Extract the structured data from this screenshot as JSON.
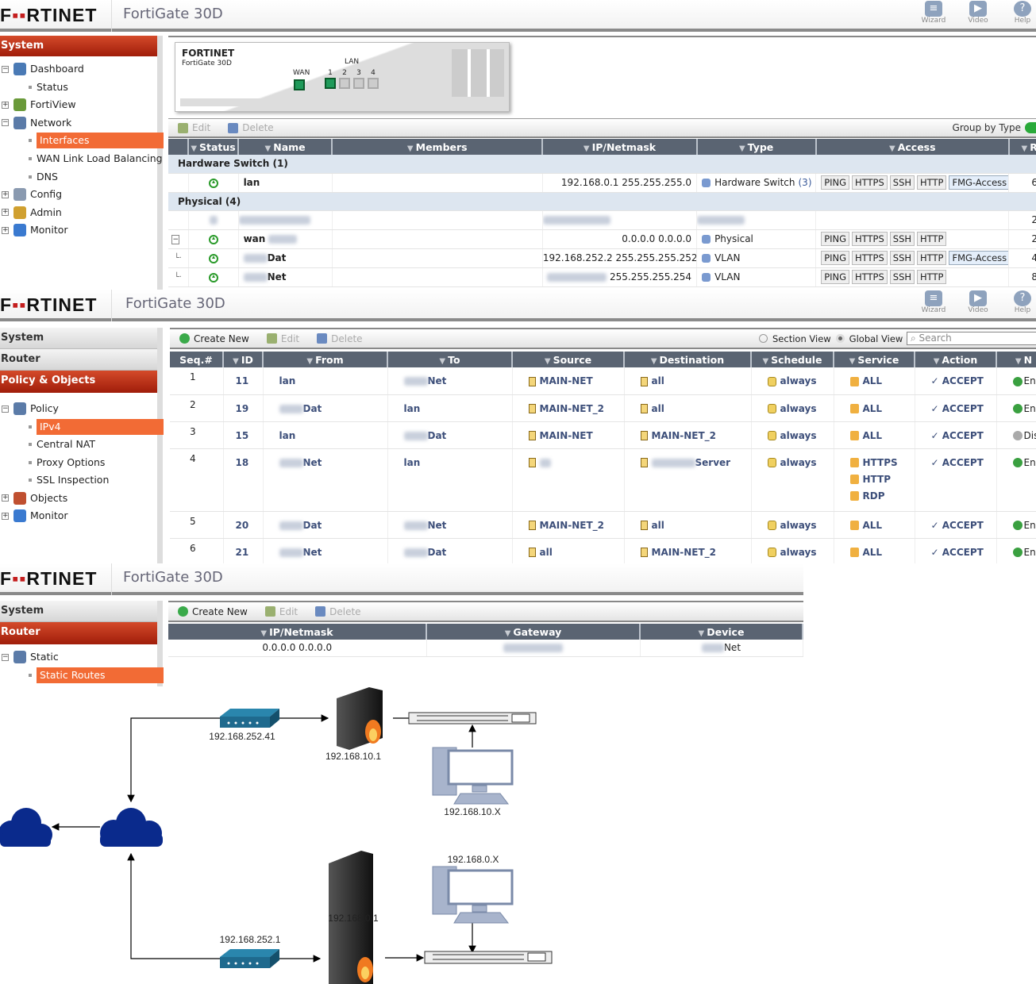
{
  "app": {
    "logo": "FORTINET",
    "product": "FortiGate 30D",
    "header_buttons": [
      {
        "label": "Wizard",
        "icon": "wizard-icon"
      },
      {
        "label": "Video",
        "icon": "video-icon"
      },
      {
        "label": "Help",
        "icon": "help-icon"
      }
    ]
  },
  "panel1": {
    "sidebar": {
      "section": "System",
      "items": [
        {
          "label": "Dashboard",
          "level": 0,
          "expander": "−",
          "icon": "dashboard-icon",
          "color": "#4a7ab5"
        },
        {
          "label": "Status",
          "level": 1
        },
        {
          "label": "FortiView",
          "level": 0,
          "expander": "+",
          "icon": "fortiview-icon",
          "color": "#6a9a3a"
        },
        {
          "label": "Network",
          "level": 0,
          "expander": "−",
          "icon": "network-icon",
          "color": "#5b7ba8"
        },
        {
          "label": "Interfaces",
          "level": 1,
          "selected": true
        },
        {
          "label": "WAN Link Load Balancing",
          "level": 1
        },
        {
          "label": "DNS",
          "level": 1
        },
        {
          "label": "Config",
          "level": 0,
          "expander": "+",
          "icon": "config-icon",
          "color": "#8a9ab0"
        },
        {
          "label": "Admin",
          "level": 0,
          "expander": "+",
          "icon": "admin-icon",
          "color": "#d0a030"
        },
        {
          "label": "Monitor",
          "level": 0,
          "expander": "+",
          "icon": "monitor-icon",
          "color": "#3a7ad0"
        }
      ]
    },
    "device": {
      "brand": "FORTINET",
      "model": "FortiGate 30D",
      "wan_label": "WAN",
      "lan_label": "LAN",
      "ports": [
        "1",
        "2",
        "3",
        "4"
      ],
      "active_ports": [
        true,
        false,
        false,
        false
      ]
    },
    "toolbar": {
      "edit": "Edit",
      "delete": "Delete",
      "group_by": "Group by Type"
    },
    "columns": [
      "Status",
      "Name",
      "Members",
      "IP/Netmask",
      "Type",
      "Access",
      "Re"
    ],
    "rows": [
      {
        "group": "Hardware Switch (1)"
      },
      {
        "status": "up",
        "name": "lan",
        "ip": "192.168.0.1 255.255.255.0",
        "type": "Hardware Switch",
        "type_count": "(3)",
        "type_icon": "hardware-switch-icon",
        "access": [
          "PING",
          "HTTPS",
          "SSH",
          "HTTP",
          "FMG-Access"
        ],
        "ref": "6"
      },
      {
        "group": "Physical (4)"
      },
      {
        "blurred": true,
        "ref": "2"
      },
      {
        "status": "up",
        "name": "wan",
        "name_blur_suffix": true,
        "expander": "−",
        "ip": "0.0.0.0 0.0.0.0",
        "type": "Physical",
        "type_icon": "physical-icon",
        "access": [
          "PING",
          "HTTPS",
          "SSH",
          "HTTP"
        ],
        "ref": "2"
      },
      {
        "status": "up",
        "name": "Dat",
        "name_blur_prefix": true,
        "child": true,
        "ip": "192.168.252.2 255.255.255.252",
        "type": "VLAN",
        "type_icon": "vlan-icon",
        "access": [
          "PING",
          "HTTPS",
          "SSH",
          "HTTP",
          "FMG-Access"
        ],
        "ref": "4"
      },
      {
        "status": "up",
        "name": "Net",
        "name_blur_prefix": true,
        "child": true,
        "ip": "255.255.255.254",
        "ip_blur_prefix": true,
        "type": "VLAN",
        "type_icon": "vlan-icon",
        "access": [
          "PING",
          "HTTPS",
          "SSH",
          "HTTP"
        ],
        "ref": "8"
      }
    ]
  },
  "panel2": {
    "sidebar": {
      "sections": [
        "System",
        "Router",
        "Policy & Objects"
      ],
      "items": [
        {
          "label": "Policy",
          "level": 0,
          "expander": "−",
          "icon": "policy-icon",
          "color": "#5b7ba8"
        },
        {
          "label": "IPv4",
          "level": 1,
          "selected": true
        },
        {
          "label": "Central NAT",
          "level": 1
        },
        {
          "label": "Proxy Options",
          "level": 1
        },
        {
          "label": "SSL Inspection",
          "level": 1
        },
        {
          "label": "Objects",
          "level": 0,
          "expander": "+",
          "icon": "objects-icon",
          "color": "#c05030"
        },
        {
          "label": "Monitor",
          "level": 0,
          "expander": "+",
          "icon": "monitor-icon",
          "color": "#3a7ad0"
        }
      ]
    },
    "toolbar": {
      "create": "Create New",
      "edit": "Edit",
      "delete": "Delete",
      "section_view": "Section View",
      "global_view": "Global View",
      "search_placeholder": "Search"
    },
    "columns": [
      "Seq.#",
      "ID",
      "From",
      "To",
      "Source",
      "Destination",
      "Schedule",
      "Service",
      "Action",
      "N"
    ],
    "rows": [
      {
        "seq": "1",
        "id": "11",
        "from": "lan",
        "to": "Net",
        "to_blur": true,
        "source": "MAIN-NET",
        "destination": "all",
        "schedule": "always",
        "service": [
          "ALL"
        ],
        "action": "ACCEPT",
        "status": "En",
        "enabled": true
      },
      {
        "seq": "2",
        "id": "19",
        "from": "Dat",
        "from_blur": true,
        "to": "lan",
        "source": "MAIN-NET_2",
        "destination": "all",
        "schedule": "always",
        "service": [
          "ALL"
        ],
        "action": "ACCEPT",
        "status": "En",
        "enabled": true
      },
      {
        "seq": "3",
        "id": "15",
        "from": "lan",
        "to": "Dat",
        "to_blur": true,
        "source": "MAIN-NET",
        "destination": "MAIN-NET_2",
        "schedule": "always",
        "service": [
          "ALL"
        ],
        "action": "ACCEPT",
        "status": "Dis",
        "enabled": false
      },
      {
        "seq": "4",
        "id": "18",
        "from": "Net",
        "from_blur": true,
        "to": "lan",
        "source": "",
        "source_blur": true,
        "destination": "Server",
        "destination_blur": true,
        "schedule": "always",
        "service": [
          "HTTPS",
          "HTTP",
          "RDP"
        ],
        "action": "ACCEPT",
        "status": "En",
        "enabled": true
      },
      {
        "seq": "5",
        "id": "20",
        "from": "Dat",
        "from_blur": true,
        "to": "Net",
        "to_blur": true,
        "source": "MAIN-NET_2",
        "destination": "all",
        "schedule": "always",
        "service": [
          "ALL"
        ],
        "action": "ACCEPT",
        "status": "En",
        "enabled": true
      },
      {
        "seq": "6",
        "id": "21",
        "from": "Net",
        "from_blur": true,
        "to": "Dat",
        "to_blur": true,
        "source": "all",
        "destination": "MAIN-NET_2",
        "schedule": "always",
        "service": [
          "ALL"
        ],
        "action": "ACCEPT",
        "status": "En",
        "enabled": true
      }
    ]
  },
  "panel3": {
    "sidebar": {
      "sections": [
        "System",
        "Router"
      ],
      "items": [
        {
          "label": "Static",
          "level": 0,
          "expander": "−",
          "icon": "static-icon",
          "color": "#5b7ba8"
        },
        {
          "label": "Static Routes",
          "level": 1,
          "selected": true
        }
      ]
    },
    "toolbar": {
      "create": "Create New",
      "edit": "Edit",
      "delete": "Delete"
    },
    "columns": [
      "IP/Netmask",
      "Gateway",
      "Device"
    ],
    "rows": [
      {
        "ip": "0.0.0.0 0.0.0.0",
        "gateway_blur": true,
        "device": "Net",
        "device_blur": true
      }
    ]
  },
  "diagram": {
    "labels": {
      "modem_top": "192.168.252.41",
      "fw_top": "192.168.10.1",
      "pc_top": "192.168.10.X",
      "modem_bottom": "192.168.252.1",
      "fw_bottom": "192.168.0.1",
      "pc_bottom": "192.168.0.X"
    },
    "colors": {
      "cloud": "#0a2a8c",
      "modem": "#1f6a8e",
      "pc": "#a8b4cc"
    }
  }
}
